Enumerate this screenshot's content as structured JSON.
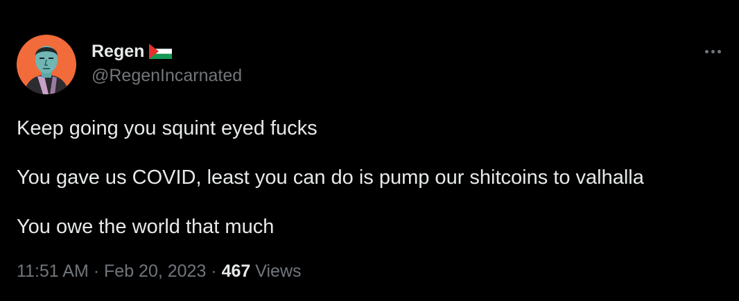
{
  "author": {
    "display_name": "Regen",
    "handle": "@RegenIncarnated",
    "flag_icon": "palestine-flag-icon",
    "avatar_bg": "#f26b3a"
  },
  "tweet": {
    "lines": [
      "Keep going you squint eyed fucks",
      "You gave us COVID, least you can do is pump our shitcoins to valhalla",
      "You owe the world that much"
    ],
    "time": "11:51 AM",
    "separator": "·",
    "date": "Feb 20, 2023",
    "views_count": "467",
    "views_label": "Views"
  },
  "menu": {
    "icon": "more-options-icon"
  },
  "colors": {
    "background": "#000000",
    "primary_text": "#e7e9ea",
    "secondary_text": "#71767b"
  }
}
